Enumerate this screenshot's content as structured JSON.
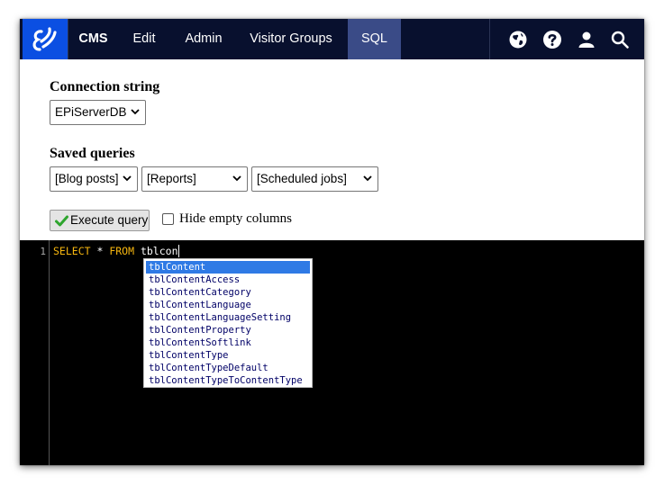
{
  "nav": {
    "items": [
      {
        "label": "CMS"
      },
      {
        "label": "Edit"
      },
      {
        "label": "Admin"
      },
      {
        "label": "Visitor Groups"
      },
      {
        "label": "SQL"
      }
    ],
    "active": "SQL",
    "icons": [
      "globe-icon",
      "help-icon",
      "user-icon",
      "search-icon"
    ]
  },
  "connection": {
    "heading": "Connection string",
    "selected": "EPiServerDB"
  },
  "saved_queries": {
    "heading": "Saved queries",
    "selects": [
      "[Blog posts]",
      "[Reports]",
      "[Scheduled jobs]"
    ]
  },
  "actions": {
    "execute_label": "Execute query",
    "hide_empty_label": "Hide empty columns",
    "hide_empty_checked": false
  },
  "editor": {
    "line_number": "1",
    "keyword1": "SELECT",
    "op": " * ",
    "keyword2": "FROM",
    "typed": " tblcon",
    "autocomplete": [
      "tblContent",
      "tblContentAccess",
      "tblContentCategory",
      "tblContentLanguage",
      "tblContentLanguageSetting",
      "tblContentProperty",
      "tblContentSoftlink",
      "tblContentType",
      "tblContentTypeDefault",
      "tblContentTypeToContentType"
    ],
    "selected_index": 0
  },
  "colors": {
    "nav_bg": "#08102e",
    "logo_bg": "#0b4fe2",
    "active_tab": "#3a4b87",
    "keyword": "#f5b50f",
    "selection": "#2f7ae5"
  }
}
